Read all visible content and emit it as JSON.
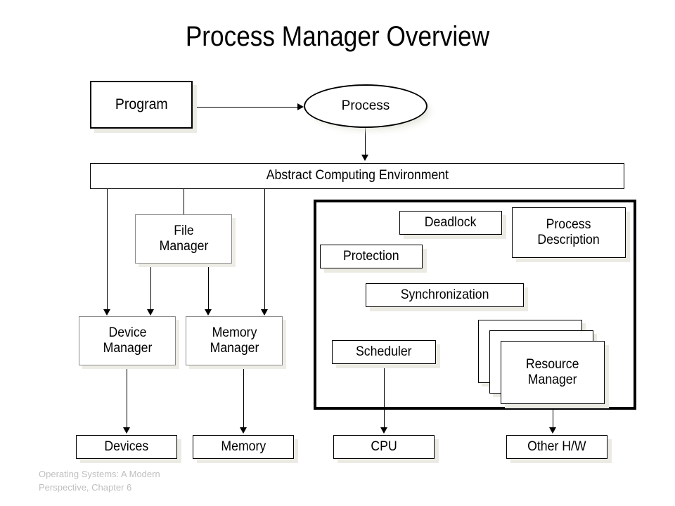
{
  "slide": {
    "title": "Process Manager Overview",
    "footer_line1": "Operating Systems: A Modern",
    "footer_line2": "Perspective, Chapter 6",
    "footer_color": "#bfbfbf",
    "background": "#ffffff",
    "shadow_color": "#ebebe4"
  },
  "nodes": {
    "program": "Program",
    "process": "Process",
    "abstract_computing_environment": "Abstract Computing Environment",
    "file_manager": "File\nManager",
    "device_manager": "Device\nManager",
    "memory_manager": "Memory\nManager",
    "deadlock": "Deadlock",
    "process_description": "Process\nDescription",
    "protection": "Protection",
    "synchronization": "Synchronization",
    "scheduler": "Scheduler",
    "resource_manager": "Resource\nManager",
    "devices": "Devices",
    "memory": "Memory",
    "cpu": "CPU",
    "other_hw": "Other H/W"
  }
}
